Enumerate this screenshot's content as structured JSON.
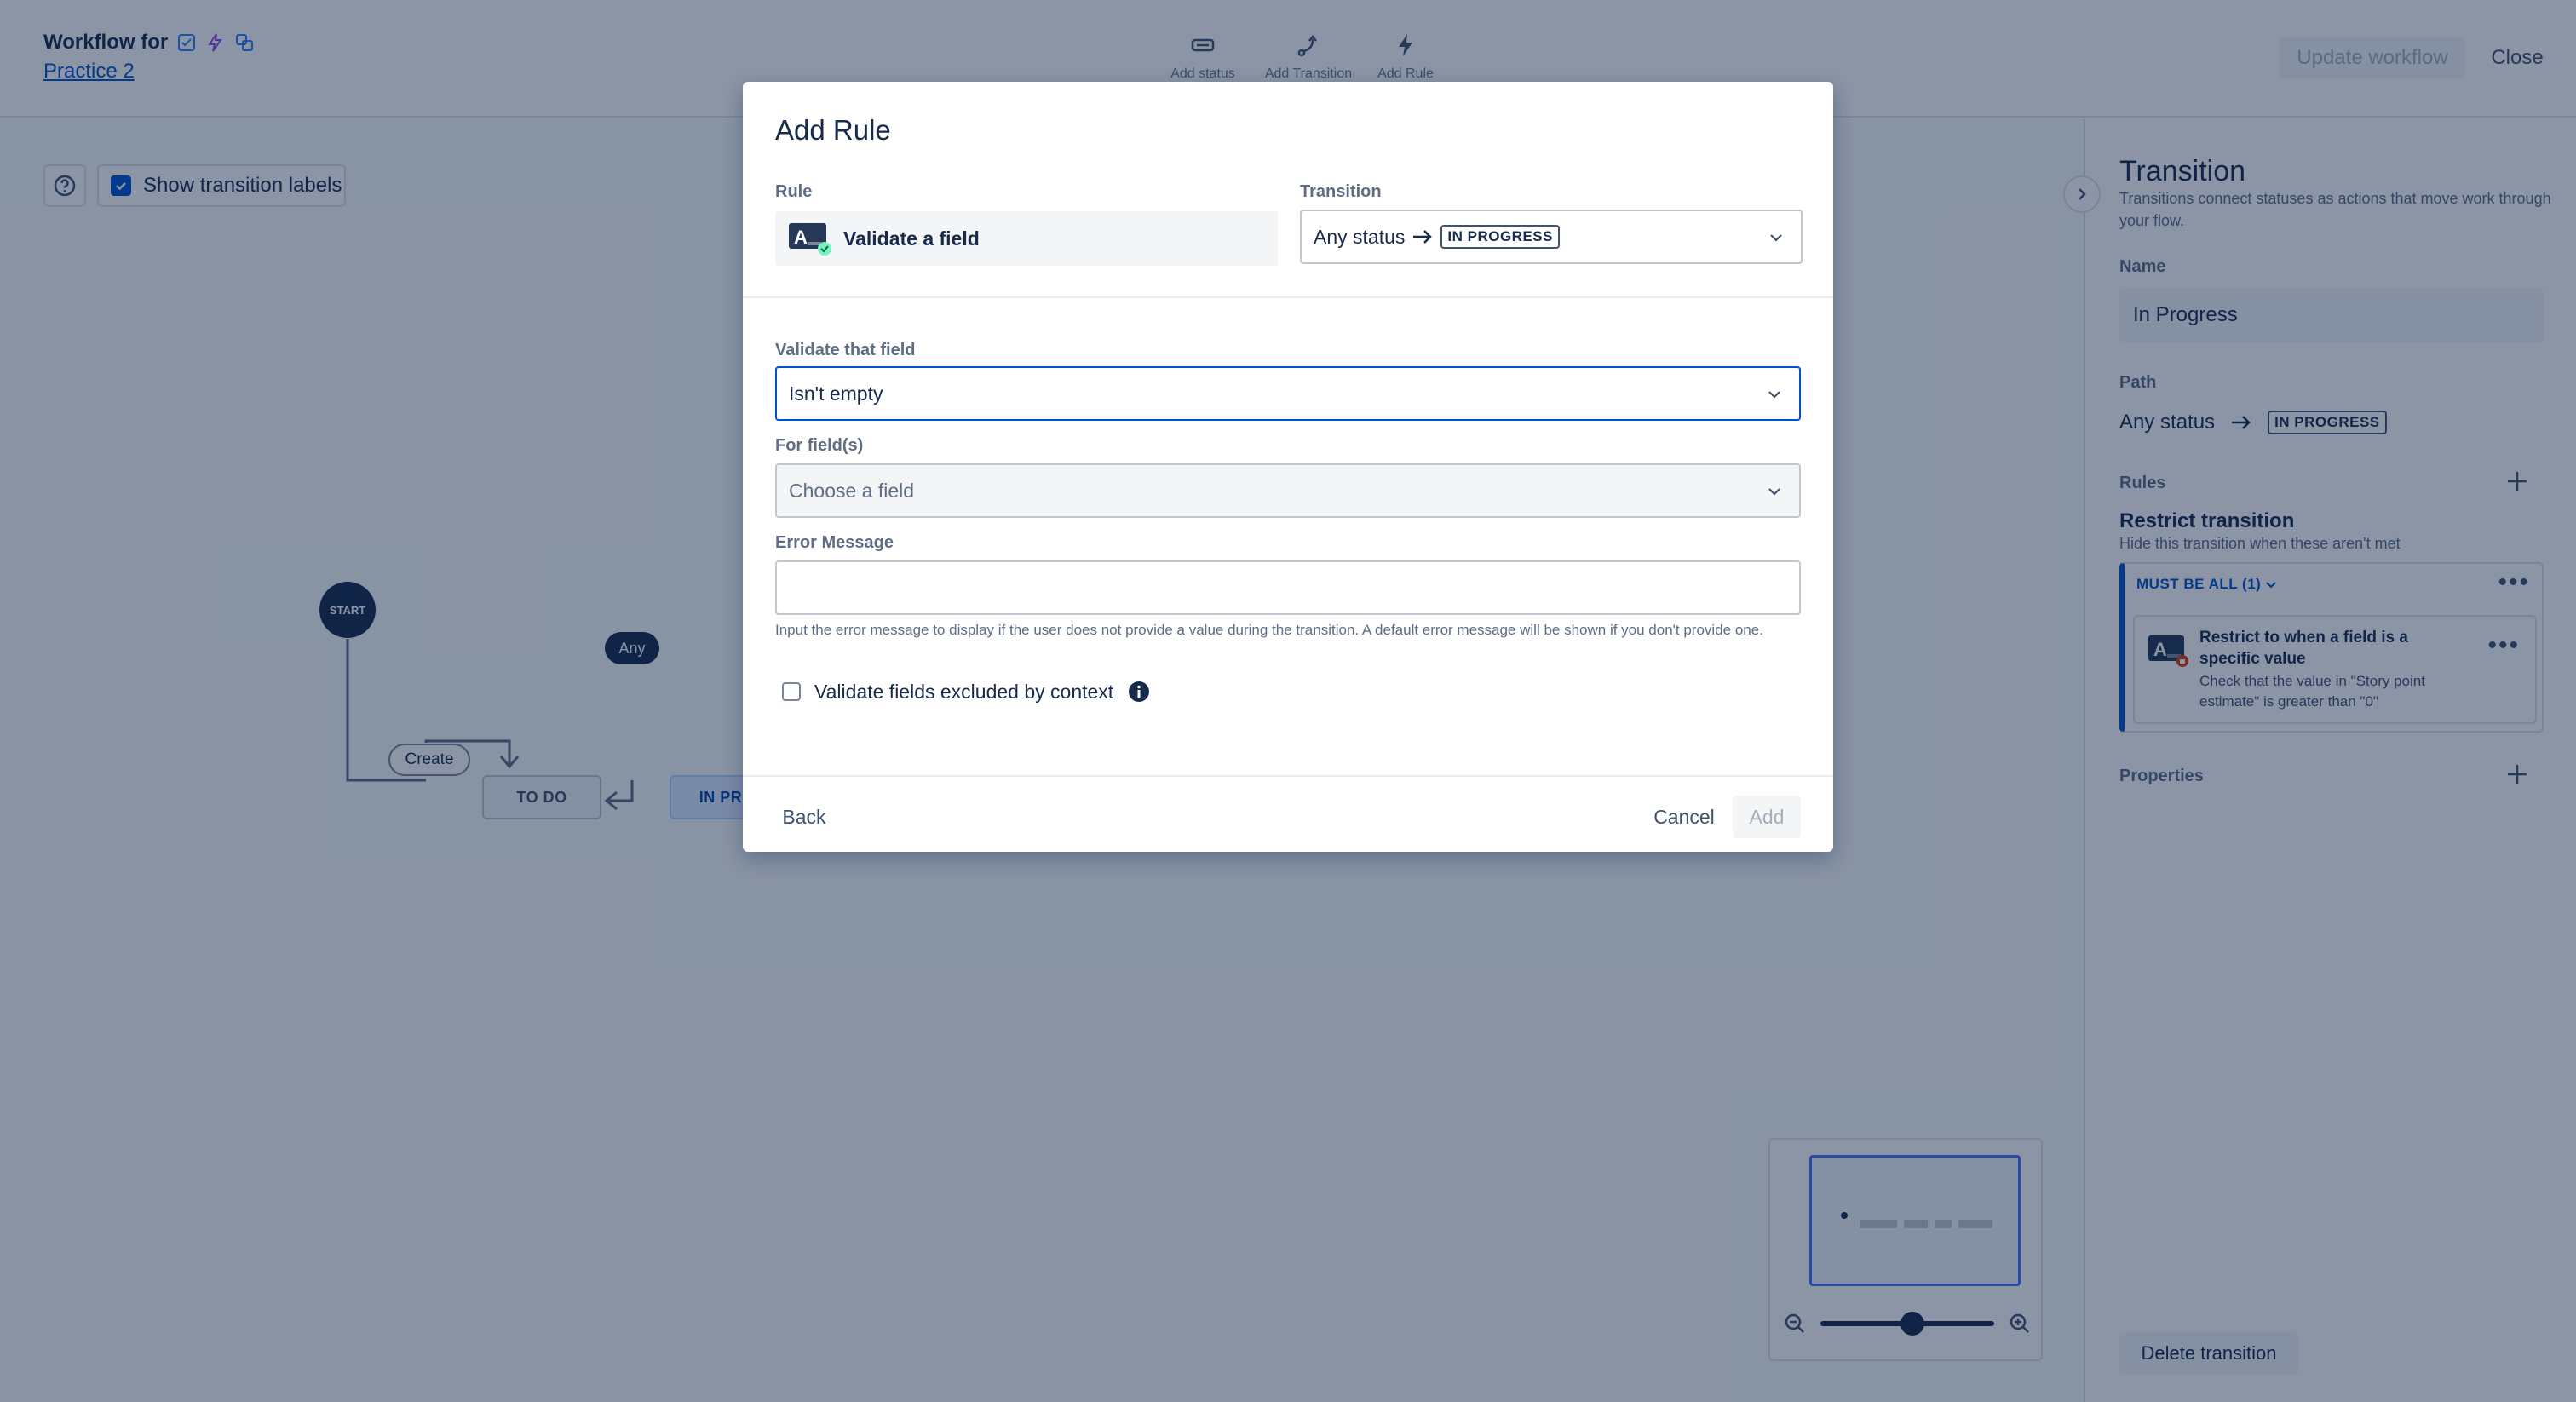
{
  "header": {
    "workflow_for": "Workflow for",
    "project_link": "Practice 2",
    "tools": [
      {
        "label": "Add status",
        "icon": "status-icon"
      },
      {
        "label": "Add Transition",
        "icon": "transition-icon"
      },
      {
        "label": "Add Rule",
        "icon": "lightning-icon"
      }
    ],
    "update_button": "Update workflow",
    "close_button": "Close"
  },
  "canvas": {
    "show_labels": "Show transition labels",
    "start_node": "START",
    "create_label": "Create",
    "any_label": "Any",
    "statuses": [
      "TO DO",
      "IN PROGRESS"
    ]
  },
  "panel": {
    "title": "Transition",
    "description": "Transitions connect statuses as actions that move work through your flow.",
    "name_label": "Name",
    "name_value": "In Progress",
    "path_label": "Path",
    "path_from": "Any status",
    "path_to": "IN PROGRESS",
    "rules_label": "Rules",
    "restrict_title": "Restrict transition",
    "restrict_sub": "Hide this transition when these aren't met",
    "must_be_all": "MUST BE ALL (1)",
    "rule_card_title": "Restrict to when a field is a specific value",
    "rule_card_desc": "Check that the value in \"Story point estimate\" is greater than \"0\"",
    "properties_label": "Properties",
    "delete_button": "Delete transition"
  },
  "modal": {
    "title": "Add Rule",
    "rule_label": "Rule",
    "rule_value": "Validate a field",
    "transition_label": "Transition",
    "transition_from": "Any status",
    "transition_to": "IN PROGRESS",
    "validate_label": "Validate that field",
    "validate_value": "Isn't empty",
    "for_fields_label": "For field(s)",
    "for_fields_placeholder": "Choose a field",
    "error_label": "Error Message",
    "error_help": "Input the error message to display if the user does not provide a value during the transition. A default error message will be shown if you don't provide one.",
    "excluded_label": "Validate fields excluded by context",
    "back_button": "Back",
    "cancel_button": "Cancel",
    "add_button": "Add"
  },
  "colors": {
    "accent": "#0052cc",
    "overlay": "#091e42",
    "text": "#172b4d"
  }
}
